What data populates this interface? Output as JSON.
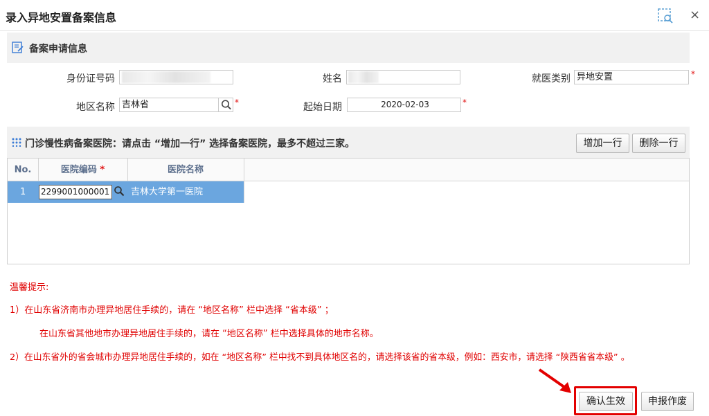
{
  "dialog": {
    "title": "录入异地安置备案信息"
  },
  "section1": {
    "title": "备案申请信息",
    "id_label": "身份证号码",
    "name_label": "姓名",
    "category_label": "就医类别",
    "category_value": "异地安置",
    "region_label": "地区名称",
    "region_value": "吉林省",
    "start_label": "起始日期",
    "start_value": "2020-02-03",
    "required_mark": "*"
  },
  "section2": {
    "title": "门诊慢性病备案医院：请点击 “增加一行” 选择备案医院，最多不超过三家。",
    "add_row": "增加一行",
    "delete_row": "删除一行"
  },
  "table": {
    "headers": [
      "No.",
      "医院编码",
      "医院名称"
    ],
    "required_mark": "*",
    "rows": [
      {
        "no": "1",
        "code": "2299001000001",
        "name": "吉林大学第一医院"
      }
    ]
  },
  "tips": {
    "title": "温馨提示:",
    "line1": "1）在山东省济南市办理异地居住手续的，请在 “地区名称” 栏中选择 “省本级” ；",
    "line2": "在山东省其他地市办理异地居住手续的，请在 “地区名称” 栏中选择具体的地市名称。",
    "line3": "2）在山东省外的省会城市办理异地居住手续的，如在 “地区名称” 栏中找不到具体地区名的，请选择该省的省本级，例如：西安市，请选择 “陕西省省本级” 。"
  },
  "footer": {
    "confirm": "确认生效",
    "void": "申报作废"
  },
  "colors": {
    "selected_row": "#6ba6df",
    "highlight": "#e30000",
    "tip_text": "#e00000"
  }
}
